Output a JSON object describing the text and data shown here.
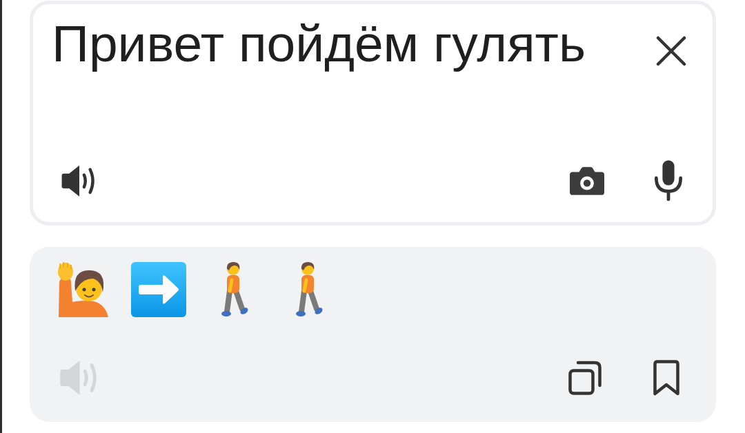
{
  "input": {
    "text": "Привет пойдём гулять",
    "speaker": {
      "disabled": false
    }
  },
  "output": {
    "emojis": [
      {
        "kind": "person-raising-hand"
      },
      {
        "kind": "arrow-right"
      },
      {
        "kind": "person-walking"
      },
      {
        "kind": "person-walking"
      }
    ],
    "speaker": {
      "disabled": true
    }
  }
}
